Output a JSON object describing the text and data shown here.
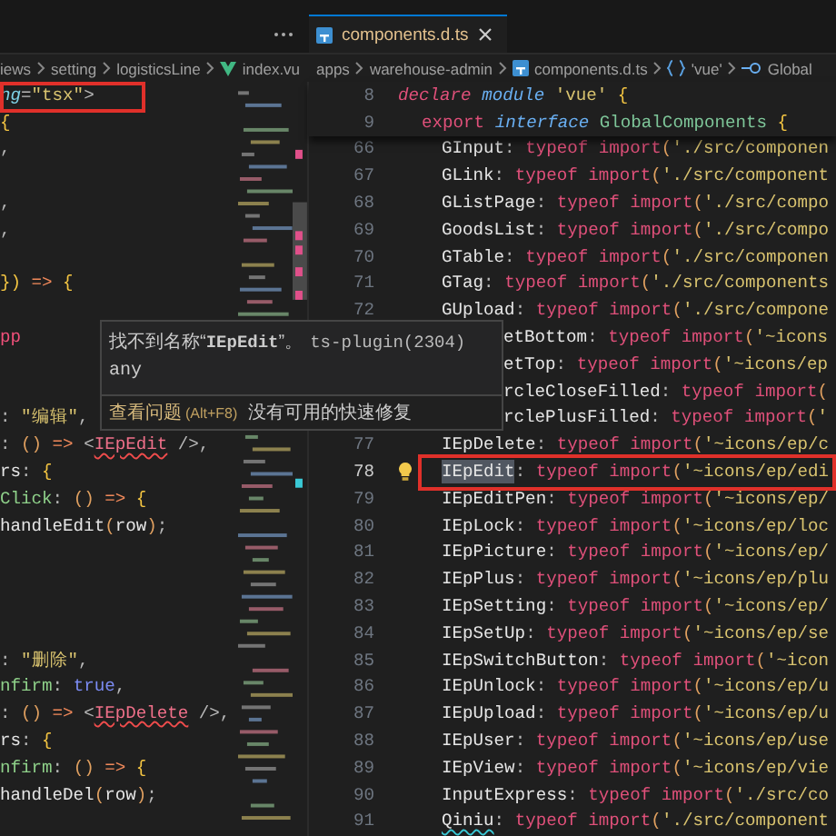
{
  "tabs": [
    {
      "label": "components.d.ts",
      "selected": true
    }
  ],
  "left_breadcrumbs": [
    {
      "kind": "folder",
      "label": "iews"
    },
    {
      "kind": "folder",
      "label": "setting"
    },
    {
      "kind": "folder",
      "label": "logisticsLine"
    },
    {
      "kind": "vue-file",
      "label": "index.vu"
    }
  ],
  "right_breadcrumbs": [
    {
      "kind": "folder",
      "label": "apps"
    },
    {
      "kind": "folder",
      "label": "warehouse-admin"
    },
    {
      "kind": "ts-file",
      "label": "components.d.ts"
    },
    {
      "kind": "module",
      "label": "'vue'"
    },
    {
      "kind": "interface",
      "label": "Global"
    }
  ],
  "left_lines": [
    {
      "boxed": true,
      "tokens": [
        {
          "kind": "attr",
          "text": "ng"
        },
        {
          "kind": "punct",
          "text": "="
        },
        {
          "kind": "string",
          "text": "\"tsx\""
        },
        {
          "kind": "punct",
          "text": ">"
        }
      ]
    },
    {
      "boxed": false,
      "tokens": [
        {
          "kind": "brace",
          "text": "{"
        }
      ]
    },
    {
      "boxed": false,
      "tokens": [
        {
          "kind": "punct",
          "text": ","
        }
      ]
    },
    {
      "boxed": false
    },
    {
      "boxed": false,
      "tokens": [
        {
          "kind": "punct",
          "text": ","
        }
      ]
    },
    {
      "boxed": false,
      "tokens": [
        {
          "kind": "punct",
          "text": ","
        }
      ]
    },
    {
      "boxed": false
    },
    {
      "boxed": false,
      "tokens": [
        {
          "kind": "brace",
          "text": "})"
        },
        {
          "kind": "arrow",
          "text": " => "
        },
        {
          "kind": "brace",
          "text": "{"
        }
      ]
    },
    {
      "boxed": false
    },
    {
      "boxed": false,
      "tokens": [
        {
          "kind": "tag",
          "text": "pp"
        }
      ]
    },
    {
      "boxed": false
    },
    {
      "boxed": false
    },
    {
      "boxed": false,
      "tokens": [
        {
          "kind": "punct",
          "text": ": "
        },
        {
          "kind": "string",
          "text": "\"编辑\""
        },
        {
          "kind": "punct",
          "text": ","
        }
      ]
    },
    {
      "boxed": false,
      "tokens": [
        {
          "kind": "punct",
          "text": ": "
        },
        {
          "kind": "paren",
          "text": "()"
        },
        {
          "kind": "arrow",
          "text": " => "
        },
        {
          "kind": "punct",
          "text": "<"
        },
        {
          "kind": "error",
          "text": "IEpEdit"
        },
        {
          "kind": "punct",
          "text": " />,"
        }
      ]
    },
    {
      "boxed": false,
      "tokens": [
        {
          "kind": "prop",
          "text": "rs"
        },
        {
          "kind": "punct",
          "text": ": "
        },
        {
          "kind": "brace",
          "text": "{"
        }
      ]
    },
    {
      "boxed": false,
      "tokens": [
        {
          "kind": "method",
          "text": "Click"
        },
        {
          "kind": "punct",
          "text": ": "
        },
        {
          "kind": "paren",
          "text": "()"
        },
        {
          "kind": "arrow",
          "text": " => "
        },
        {
          "kind": "brace",
          "text": "{"
        }
      ]
    },
    {
      "boxed": false,
      "tokens": [
        {
          "kind": "prop",
          "text": "handleEdit"
        },
        {
          "kind": "paren",
          "text": "("
        },
        {
          "kind": "prop",
          "text": "row"
        },
        {
          "kind": "paren",
          "text": ")"
        },
        {
          "kind": "punct",
          "text": ";"
        }
      ]
    },
    {
      "boxed": false
    },
    {
      "boxed": false
    },
    {
      "boxed": false
    },
    {
      "boxed": false
    },
    {
      "boxed": false,
      "tokens": [
        {
          "kind": "punct",
          "text": ": "
        },
        {
          "kind": "string",
          "text": "\"删除\""
        },
        {
          "kind": "punct",
          "text": ","
        }
      ]
    },
    {
      "boxed": false,
      "tokens": [
        {
          "kind": "method",
          "text": "nfirm"
        },
        {
          "kind": "punct",
          "text": ": "
        },
        {
          "kind": "bool",
          "text": "true"
        },
        {
          "kind": "punct",
          "text": ","
        }
      ]
    },
    {
      "boxed": false,
      "tokens": [
        {
          "kind": "punct",
          "text": ": "
        },
        {
          "kind": "paren",
          "text": "()"
        },
        {
          "kind": "arrow",
          "text": " => "
        },
        {
          "kind": "punct",
          "text": "<"
        },
        {
          "kind": "error",
          "text": "IEpDelete"
        },
        {
          "kind": "punct",
          "text": " />,"
        }
      ]
    },
    {
      "boxed": false,
      "tokens": [
        {
          "kind": "prop",
          "text": "rs"
        },
        {
          "kind": "punct",
          "text": ": "
        },
        {
          "kind": "brace",
          "text": "{"
        }
      ]
    },
    {
      "boxed": false,
      "tokens": [
        {
          "kind": "method",
          "text": "nfirm"
        },
        {
          "kind": "punct",
          "text": ": "
        },
        {
          "kind": "paren",
          "text": "()"
        },
        {
          "kind": "arrow",
          "text": " => "
        },
        {
          "kind": "brace",
          "text": "{"
        }
      ]
    },
    {
      "boxed": false,
      "tokens": [
        {
          "kind": "prop",
          "text": "handleDel"
        },
        {
          "kind": "paren",
          "text": "("
        },
        {
          "kind": "prop",
          "text": "row"
        },
        {
          "kind": "paren",
          "text": ")"
        },
        {
          "kind": "punct",
          "text": ";"
        }
      ]
    },
    {
      "boxed": false
    }
  ],
  "sticky_lines": [
    {
      "number": "8",
      "tokens": [
        {
          "kind": "italic-keyword",
          "text": "declare"
        },
        {
          "kind": "italic-type",
          "text": " module "
        },
        {
          "kind": "string",
          "text": "'vue'"
        },
        {
          "kind": "brace",
          "text": " {"
        }
      ]
    },
    {
      "number": "9",
      "tokens": [
        {
          "kind": "keyword",
          "text": "export "
        },
        {
          "kind": "italic-type",
          "text": "interface "
        },
        {
          "kind": "class",
          "text": "GlobalComponents"
        },
        {
          "kind": "brace",
          "text": " {"
        }
      ]
    }
  ],
  "right_lines": [
    {
      "number": "66",
      "covered": false,
      "active": false,
      "boxed": false,
      "lightbulb": false,
      "name_highlighted": false,
      "warning": false,
      "name": "GInput",
      "colon": ":",
      "keyword": "typeof import",
      "paren": "(",
      "string": "'./src/componen"
    },
    {
      "number": "67",
      "covered": false,
      "active": false,
      "boxed": false,
      "lightbulb": false,
      "name_highlighted": false,
      "warning": false,
      "name": "GLink",
      "colon": ":",
      "keyword": "typeof import",
      "paren": "(",
      "string": "'./src/component"
    },
    {
      "number": "68",
      "covered": false,
      "active": false,
      "boxed": false,
      "lightbulb": false,
      "name_highlighted": false,
      "warning": false,
      "name": "GListPage",
      "colon": ":",
      "keyword": "typeof import",
      "paren": "(",
      "string": "'./src/compo"
    },
    {
      "number": "69",
      "covered": false,
      "active": false,
      "boxed": false,
      "lightbulb": false,
      "name_highlighted": false,
      "warning": false,
      "name": "GoodsList",
      "colon": ":",
      "keyword": "typeof import",
      "paren": "(",
      "string": "'./src/compo"
    },
    {
      "number": "70",
      "covered": false,
      "active": false,
      "boxed": false,
      "lightbulb": false,
      "name_highlighted": false,
      "warning": false,
      "name": "GTable",
      "colon": ":",
      "keyword": "typeof import",
      "paren": "(",
      "string": "'./src/componen"
    },
    {
      "number": "71",
      "covered": false,
      "active": false,
      "boxed": false,
      "lightbulb": false,
      "name_highlighted": false,
      "warning": false,
      "name": "GTag",
      "colon": ":",
      "keyword": "typeof import",
      "paren": "(",
      "string": "'./src/components"
    },
    {
      "number": "72",
      "covered": false,
      "active": false,
      "boxed": false,
      "lightbulb": false,
      "name_highlighted": false,
      "warning": false,
      "name": "GUpload",
      "colon": ":",
      "keyword": "typeof import",
      "paren": "(",
      "string": "'./src/compone"
    },
    {
      "covered": true,
      "active": false,
      "boxed": false,
      "lightbulb": false,
      "name_highlighted": false,
      "warning": false,
      "name": "etBottom",
      "colon": ":",
      "keyword": "typeof import",
      "paren": "(",
      "string": "'~icons"
    },
    {
      "covered": true,
      "active": false,
      "boxed": false,
      "lightbulb": false,
      "name_highlighted": false,
      "warning": false,
      "name": "etTop",
      "colon": ":",
      "keyword": "typeof import",
      "paren": "(",
      "string": "'~icons/ep"
    },
    {
      "covered": true,
      "active": false,
      "boxed": false,
      "lightbulb": false,
      "name_highlighted": false,
      "warning": false,
      "name": "rcleCloseFilled",
      "colon": ":",
      "keyword": "typeof import",
      "paren": "("
    },
    {
      "covered": true,
      "active": false,
      "boxed": false,
      "lightbulb": false,
      "name_highlighted": false,
      "warning": false,
      "name": "rclePlusFilled",
      "colon": ":",
      "keyword": "typeof import",
      "paren": "(",
      "string": "'"
    },
    {
      "number": "77",
      "covered": false,
      "active": false,
      "boxed": false,
      "lightbulb": false,
      "name_highlighted": false,
      "warning": false,
      "name": "IEpDelete",
      "colon": ":",
      "keyword": "typeof import",
      "paren": "(",
      "string": "'~icons/ep/c"
    },
    {
      "number": "78",
      "covered": false,
      "active": true,
      "boxed": true,
      "lightbulb": true,
      "name_highlighted": true,
      "warning": false,
      "name": "IEpEdit",
      "colon": ":",
      "keyword": "typeof import",
      "paren": "(",
      "string": "'~icons/ep/edi"
    },
    {
      "number": "79",
      "covered": false,
      "active": false,
      "boxed": false,
      "lightbulb": false,
      "name_highlighted": false,
      "warning": false,
      "name": "IEpEditPen",
      "colon": ":",
      "keyword": "typeof import",
      "paren": "(",
      "string": "'~icons/ep/"
    },
    {
      "number": "80",
      "covered": false,
      "active": false,
      "boxed": false,
      "lightbulb": false,
      "name_highlighted": false,
      "warning": false,
      "name": "IEpLock",
      "colon": ":",
      "keyword": "typeof import",
      "paren": "(",
      "string": "'~icons/ep/loc"
    },
    {
      "number": "81",
      "covered": false,
      "active": false,
      "boxed": false,
      "lightbulb": false,
      "name_highlighted": false,
      "warning": false,
      "name": "IEpPicture",
      "colon": ":",
      "keyword": "typeof import",
      "paren": "(",
      "string": "'~icons/ep/"
    },
    {
      "number": "82",
      "covered": false,
      "active": false,
      "boxed": false,
      "lightbulb": false,
      "name_highlighted": false,
      "warning": false,
      "name": "IEpPlus",
      "colon": ":",
      "keyword": "typeof import",
      "paren": "(",
      "string": "'~icons/ep/plu"
    },
    {
      "number": "83",
      "covered": false,
      "active": false,
      "boxed": false,
      "lightbulb": false,
      "name_highlighted": false,
      "warning": false,
      "name": "IEpSetting",
      "colon": ":",
      "keyword": "typeof import",
      "paren": "(",
      "string": "'~icons/ep/"
    },
    {
      "number": "84",
      "covered": false,
      "active": false,
      "boxed": false,
      "lightbulb": false,
      "name_highlighted": false,
      "warning": false,
      "name": "IEpSetUp",
      "colon": ":",
      "keyword": "typeof import",
      "paren": "(",
      "string": "'~icons/ep/se"
    },
    {
      "number": "85",
      "covered": false,
      "active": false,
      "boxed": false,
      "lightbulb": false,
      "name_highlighted": false,
      "warning": false,
      "name": "IEpSwitchButton",
      "colon": ":",
      "keyword": "typeof import",
      "paren": "(",
      "string": "'~icon"
    },
    {
      "number": "86",
      "covered": false,
      "active": false,
      "boxed": false,
      "lightbulb": false,
      "name_highlighted": false,
      "warning": false,
      "name": "IEpUnlock",
      "colon": ":",
      "keyword": "typeof import",
      "paren": "(",
      "string": "'~icons/ep/u"
    },
    {
      "number": "87",
      "covered": false,
      "active": false,
      "boxed": false,
      "lightbulb": false,
      "name_highlighted": false,
      "warning": false,
      "name": "IEpUpload",
      "colon": ":",
      "keyword": "typeof import",
      "paren": "(",
      "string": "'~icons/ep/u"
    },
    {
      "number": "88",
      "covered": false,
      "active": false,
      "boxed": false,
      "lightbulb": false,
      "name_highlighted": false,
      "warning": false,
      "name": "IEpUser",
      "colon": ":",
      "keyword": "typeof import",
      "paren": "(",
      "string": "'~icons/ep/use"
    },
    {
      "number": "89",
      "covered": false,
      "active": false,
      "boxed": false,
      "lightbulb": false,
      "name_highlighted": false,
      "warning": false,
      "name": "IEpView",
      "colon": ":",
      "keyword": "typeof import",
      "paren": "(",
      "string": "'~icons/ep/vie"
    },
    {
      "number": "90",
      "covered": false,
      "active": false,
      "boxed": false,
      "lightbulb": false,
      "name_highlighted": false,
      "warning": false,
      "name": "InputExpress",
      "colon": ":",
      "keyword": "typeof import",
      "paren": "(",
      "string": "'./src/co"
    },
    {
      "number": "91",
      "covered": false,
      "active": false,
      "boxed": false,
      "lightbulb": false,
      "name_highlighted": false,
      "warning": true,
      "name": "Qiniu",
      "colon": ":",
      "keyword": "typeof import",
      "paren": "(",
      "string": "'./src/component"
    }
  ],
  "hover_popup": {
    "message": "找不到名称“**IEpEdit**”。",
    "source": "ts-plugin(2304)",
    "type": "any",
    "link": "查看问题",
    "shortcut": "(Alt+F8)",
    "no_fix": "没有可用的快速修复"
  }
}
